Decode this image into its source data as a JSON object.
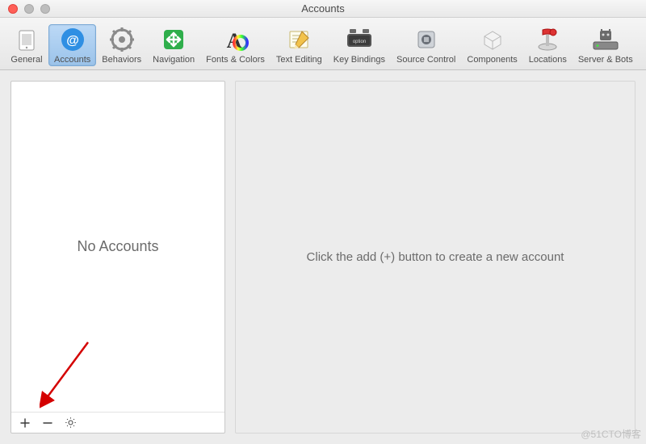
{
  "window": {
    "title": "Accounts"
  },
  "toolbar": {
    "items": [
      {
        "id": "general",
        "label": "General",
        "icon": "general-icon",
        "selected": false
      },
      {
        "id": "accounts",
        "label": "Accounts",
        "icon": "accounts-icon",
        "selected": true
      },
      {
        "id": "behaviors",
        "label": "Behaviors",
        "icon": "behaviors-icon",
        "selected": false
      },
      {
        "id": "navigation",
        "label": "Navigation",
        "icon": "navigation-icon",
        "selected": false
      },
      {
        "id": "fonts-colors",
        "label": "Fonts & Colors",
        "icon": "fonts-colors-icon",
        "selected": false
      },
      {
        "id": "text-editing",
        "label": "Text Editing",
        "icon": "text-editing-icon",
        "selected": false
      },
      {
        "id": "key-bindings",
        "label": "Key Bindings",
        "icon": "key-bindings-icon",
        "selected": false
      },
      {
        "id": "source-control",
        "label": "Source Control",
        "icon": "source-control-icon",
        "selected": false
      },
      {
        "id": "components",
        "label": "Components",
        "icon": "components-icon",
        "selected": false
      },
      {
        "id": "locations",
        "label": "Locations",
        "icon": "locations-icon",
        "selected": false
      },
      {
        "id": "server-bots",
        "label": "Server & Bots",
        "icon": "server-bots-icon",
        "selected": false
      }
    ]
  },
  "sidebar": {
    "empty_text": "No Accounts",
    "footer": {
      "add_tooltip": "Add",
      "remove_tooltip": "Remove",
      "action_tooltip": "Action"
    }
  },
  "detail": {
    "empty_text": "Click the add (+) button to create a new account"
  },
  "watermark": "@51CTO博客"
}
